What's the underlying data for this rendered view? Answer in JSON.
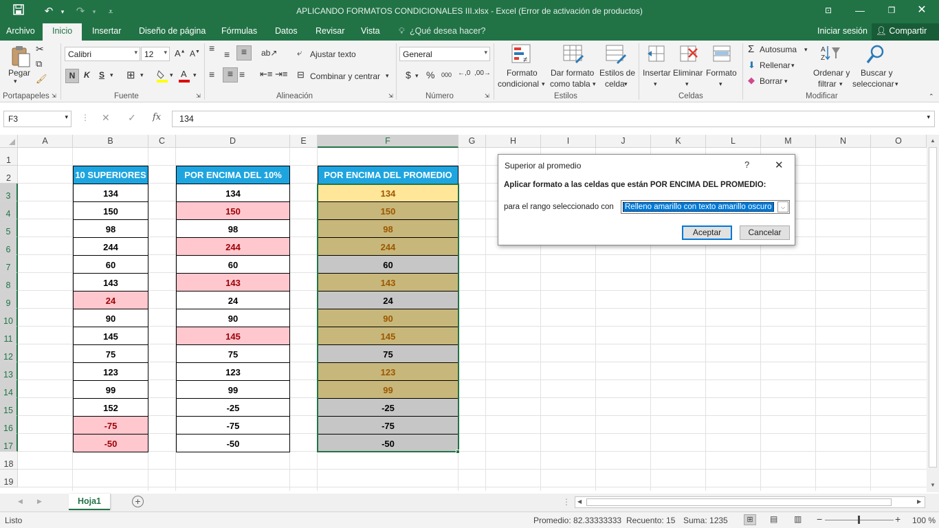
{
  "window": {
    "title": "APLICANDO FORMATOS CONDICIONALES III.xlsx - Excel (Error de activación de productos)",
    "save_icon": "save-icon",
    "undo_icon": "undo-icon",
    "redo_icon": "redo-icon"
  },
  "tabs": {
    "archivo": "Archivo",
    "inicio": "Inicio",
    "insertar": "Insertar",
    "diseno": "Diseño de página",
    "formulas": "Fórmulas",
    "datos": "Datos",
    "revisar": "Revisar",
    "vista": "Vista",
    "tell_me": "¿Qué desea hacer?",
    "signin": "Iniciar sesión",
    "share": "Compartir"
  },
  "ribbon": {
    "pegar": "Pegar",
    "portapapeles": "Portapapeles",
    "font_name": "Calibri",
    "font_size": "12",
    "bold": "N",
    "italic": "K",
    "underline": "S",
    "fuente": "Fuente",
    "ajustar": "Ajustar texto",
    "combinar": "Combinar y centrar",
    "alineacion": "Alineación",
    "number_format": "General",
    "currency": "$",
    "percent": "%",
    "thousands": "000",
    "numero": "Número",
    "formato_condicional_1": "Formato",
    "formato_condicional_2": "condicional",
    "dar_formato_1": "Dar formato",
    "dar_formato_2": "como tabla",
    "estilos_celda_1": "Estilos de",
    "estilos_celda_2": "celda",
    "estilos": "Estilos",
    "insertar": "Insertar",
    "eliminar": "Eliminar",
    "formato": "Formato",
    "celdas": "Celdas",
    "autosuma": "Autosuma",
    "rellenar": "Rellenar",
    "borrar": "Borrar",
    "ordenar_1": "Ordenar y",
    "ordenar_2": "filtrar",
    "buscar_1": "Buscar y",
    "buscar_2": "seleccionar",
    "modificar": "Modificar"
  },
  "formula_bar": {
    "name_box": "F3",
    "fx": "fx",
    "value": "134"
  },
  "columns": [
    "A",
    "B",
    "C",
    "D",
    "E",
    "F",
    "G",
    "H",
    "I",
    "J",
    "K",
    "L",
    "M",
    "N",
    "O"
  ],
  "rows": [
    "1",
    "2",
    "3",
    "4",
    "5",
    "6",
    "7",
    "8",
    "9",
    "10",
    "11",
    "12",
    "13",
    "14",
    "15",
    "16",
    "17",
    "18",
    "19"
  ],
  "tables": {
    "b_header": "10 SUPERIORES",
    "d_header": "POR ENCIMA DEL 10%",
    "f_header": "POR ENCIMA DEL PROMEDIO",
    "b_values": [
      "134",
      "150",
      "98",
      "244",
      "60",
      "143",
      "24",
      "90",
      "145",
      "75",
      "123",
      "99",
      "152",
      "-75",
      "-50"
    ],
    "d_values": [
      "134",
      "150",
      "98",
      "244",
      "60",
      "143",
      "24",
      "90",
      "145",
      "75",
      "123",
      "99",
      "-25",
      "-75",
      "-50"
    ],
    "f_values": [
      "134",
      "150",
      "98",
      "244",
      "60",
      "143",
      "24",
      "90",
      "145",
      "75",
      "123",
      "99",
      "-25",
      "-75",
      "-50"
    ],
    "b_highlight": [
      false,
      false,
      false,
      false,
      false,
      false,
      true,
      false,
      false,
      false,
      false,
      false,
      false,
      true,
      true
    ],
    "d_highlight": [
      false,
      true,
      false,
      true,
      false,
      true,
      false,
      false,
      true,
      false,
      false,
      false,
      false,
      false,
      false
    ],
    "f_highlight": [
      true,
      true,
      true,
      true,
      false,
      true,
      false,
      true,
      true,
      false,
      true,
      true,
      false,
      false,
      false
    ],
    "colors": {
      "header_bg": "#1ea5e0",
      "pink_fill": "#ffc7ce",
      "pink_text": "#9c0006",
      "yellow_fill": "#c8b77a",
      "yellow_text": "#9c5700",
      "active_fill": "#ffe699",
      "gray_fill": "#c6c6c6"
    }
  },
  "dialog": {
    "title": "Superior al promedio",
    "help": "?",
    "instruction": "Aplicar formato a las celdas que están POR ENCIMA DEL PROMEDIO:",
    "range_label": "para el rango seleccionado con",
    "format_option": "Relleno amarillo con texto amarillo oscuro",
    "ok": "Aceptar",
    "cancel": "Cancelar"
  },
  "sheet": {
    "tab": "Hoja1"
  },
  "status": {
    "mode": "Listo",
    "average": "Promedio: 82.33333333",
    "count": "Recuento: 15",
    "sum": "Suma: 1235",
    "zoom": "100 %"
  }
}
